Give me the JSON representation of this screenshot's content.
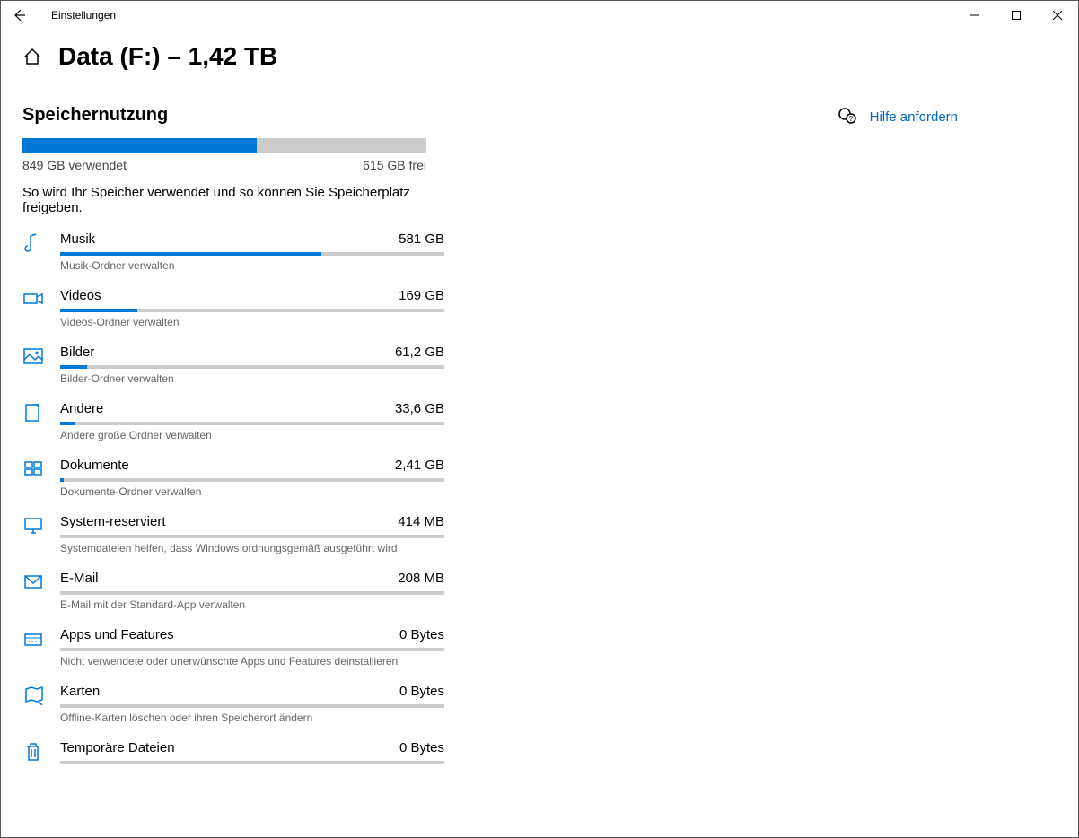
{
  "window": {
    "title": "Einstellungen"
  },
  "page": {
    "title": "Data (F:) – 1,42 TB",
    "section_title": "Speichernutzung",
    "used_label": "849 GB verwendet",
    "free_label": "615 GB frei",
    "used_pct": 58,
    "description": "So wird Ihr Speicher verwendet und so können Sie Speicherplatz freigeben."
  },
  "help": {
    "label": "Hilfe anfordern"
  },
  "categories": [
    {
      "icon": "music",
      "label": "Musik",
      "size": "581 GB",
      "pct": 68,
      "sub": "Musik-Ordner verwalten"
    },
    {
      "icon": "video",
      "label": "Videos",
      "size": "169 GB",
      "pct": 20,
      "sub": "Videos-Ordner verwalten"
    },
    {
      "icon": "pictures",
      "label": "Bilder",
      "size": "61,2 GB",
      "pct": 7,
      "sub": "Bilder-Ordner verwalten"
    },
    {
      "icon": "other",
      "label": "Andere",
      "size": "33,6 GB",
      "pct": 4,
      "sub": "Andere große Ordner verwalten"
    },
    {
      "icon": "docs",
      "label": "Dokumente",
      "size": "2,41 GB",
      "pct": 1,
      "sub": "Dokumente-Ordner verwalten"
    },
    {
      "icon": "system",
      "label": "System-reserviert",
      "size": "414 MB",
      "pct": 0,
      "sub": "Systemdateien helfen, dass Windows ordnungsgemäß ausgeführt wird"
    },
    {
      "icon": "mail",
      "label": "E-Mail",
      "size": "208 MB",
      "pct": 0,
      "sub": "E-Mail mit der Standard-App verwalten"
    },
    {
      "icon": "apps",
      "label": "Apps und Features",
      "size": "0 Bytes",
      "pct": 0,
      "sub": "Nicht verwendete oder unerwünschte Apps und Features deinstallieren"
    },
    {
      "icon": "maps",
      "label": "Karten",
      "size": "0 Bytes",
      "pct": 0,
      "sub": "Offline-Karten löschen oder ihren Speicherort ändern"
    },
    {
      "icon": "trash",
      "label": "Temporäre Dateien",
      "size": "0 Bytes",
      "pct": 0,
      "sub": ""
    }
  ]
}
